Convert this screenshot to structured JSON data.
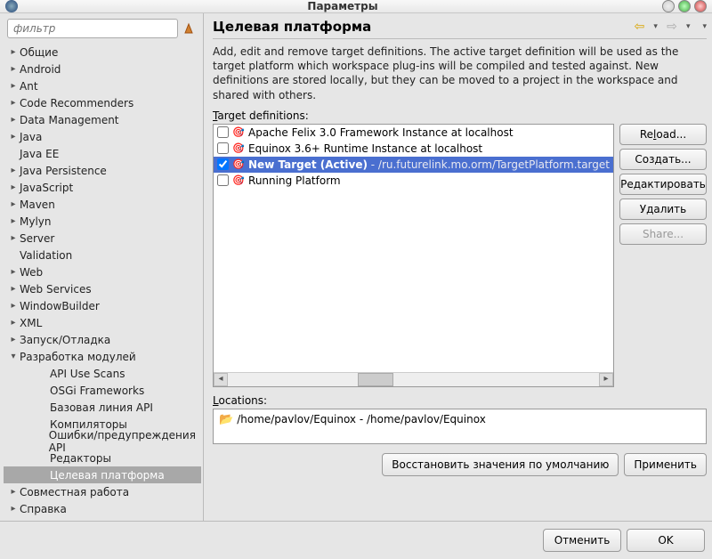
{
  "window": {
    "title": "Параметры"
  },
  "sidebar": {
    "filter_placeholder": "фильтр",
    "items": [
      {
        "label": "Общие",
        "expandable": true,
        "level": 0
      },
      {
        "label": "Android",
        "expandable": true,
        "level": 0
      },
      {
        "label": "Ant",
        "expandable": true,
        "level": 0
      },
      {
        "label": "Code Recommenders",
        "expandable": true,
        "level": 0
      },
      {
        "label": "Data Management",
        "expandable": true,
        "level": 0
      },
      {
        "label": "Java",
        "expandable": true,
        "level": 0
      },
      {
        "label": "Java EE",
        "expandable": false,
        "level": 0
      },
      {
        "label": "Java Persistence",
        "expandable": true,
        "level": 0
      },
      {
        "label": "JavaScript",
        "expandable": true,
        "level": 0
      },
      {
        "label": "Maven",
        "expandable": true,
        "level": 0
      },
      {
        "label": "Mylyn",
        "expandable": true,
        "level": 0
      },
      {
        "label": "Server",
        "expandable": true,
        "level": 0
      },
      {
        "label": "Validation",
        "expandable": false,
        "level": 0
      },
      {
        "label": "Web",
        "expandable": true,
        "level": 0
      },
      {
        "label": "Web Services",
        "expandable": true,
        "level": 0
      },
      {
        "label": "WindowBuilder",
        "expandable": true,
        "level": 0
      },
      {
        "label": "XML",
        "expandable": true,
        "level": 0
      },
      {
        "label": "Запуск/Отладка",
        "expandable": true,
        "level": 0
      },
      {
        "label": "Разработка модулей",
        "expandable": true,
        "expanded": true,
        "level": 0
      },
      {
        "label": "API Use Scans",
        "expandable": false,
        "level": 1
      },
      {
        "label": "OSGi Frameworks",
        "expandable": false,
        "level": 1
      },
      {
        "label": "Базовая линия API",
        "expandable": false,
        "level": 1
      },
      {
        "label": "Компиляторы",
        "expandable": false,
        "level": 1
      },
      {
        "label": "Ошибки/предупреждения API",
        "expandable": false,
        "level": 1
      },
      {
        "label": "Редакторы",
        "expandable": false,
        "level": 1
      },
      {
        "label": "Целевая платформа",
        "expandable": false,
        "level": 1,
        "selected": true
      },
      {
        "label": "Совместная работа",
        "expandable": true,
        "level": 0
      },
      {
        "label": "Справка",
        "expandable": true,
        "level": 0
      }
    ]
  },
  "main": {
    "heading": "Целевая платформа",
    "description": "Add, edit and remove target definitions.  The active target definition will be used as the target platform which workspace plug-ins will be compiled and tested against.  New definitions are stored locally, but they can be moved to a project in the workspace and shared with others.",
    "definitions_label": "Target definitions:",
    "definitions": [
      {
        "checked": false,
        "label": "Apache Felix 3.0 Framework Instance at localhost",
        "active": false
      },
      {
        "checked": false,
        "label": "Equinox 3.6+ Runtime Instance at localhost",
        "active": false
      },
      {
        "checked": true,
        "label_bold": "New Target (Active)",
        "path": " - /ru.futurelink.mo.orm/TargetPlatform.target",
        "selected": true,
        "active": true
      },
      {
        "checked": false,
        "label": "Running Platform",
        "active": false
      }
    ],
    "buttons": {
      "reload": "Reload...",
      "reload_ul": "l",
      "create": "Создать...",
      "edit": "Редактировать",
      "delete": "Удалить",
      "share": "Share..."
    },
    "locations_label": "Locations:",
    "location_path": "/home/pavlov/Equinox - /home/pavlov/Equinox",
    "restore_defaults": "Восстановить значения по умолчанию",
    "apply": "Применить"
  },
  "footer": {
    "cancel": "Отменить",
    "ok": "OK"
  }
}
